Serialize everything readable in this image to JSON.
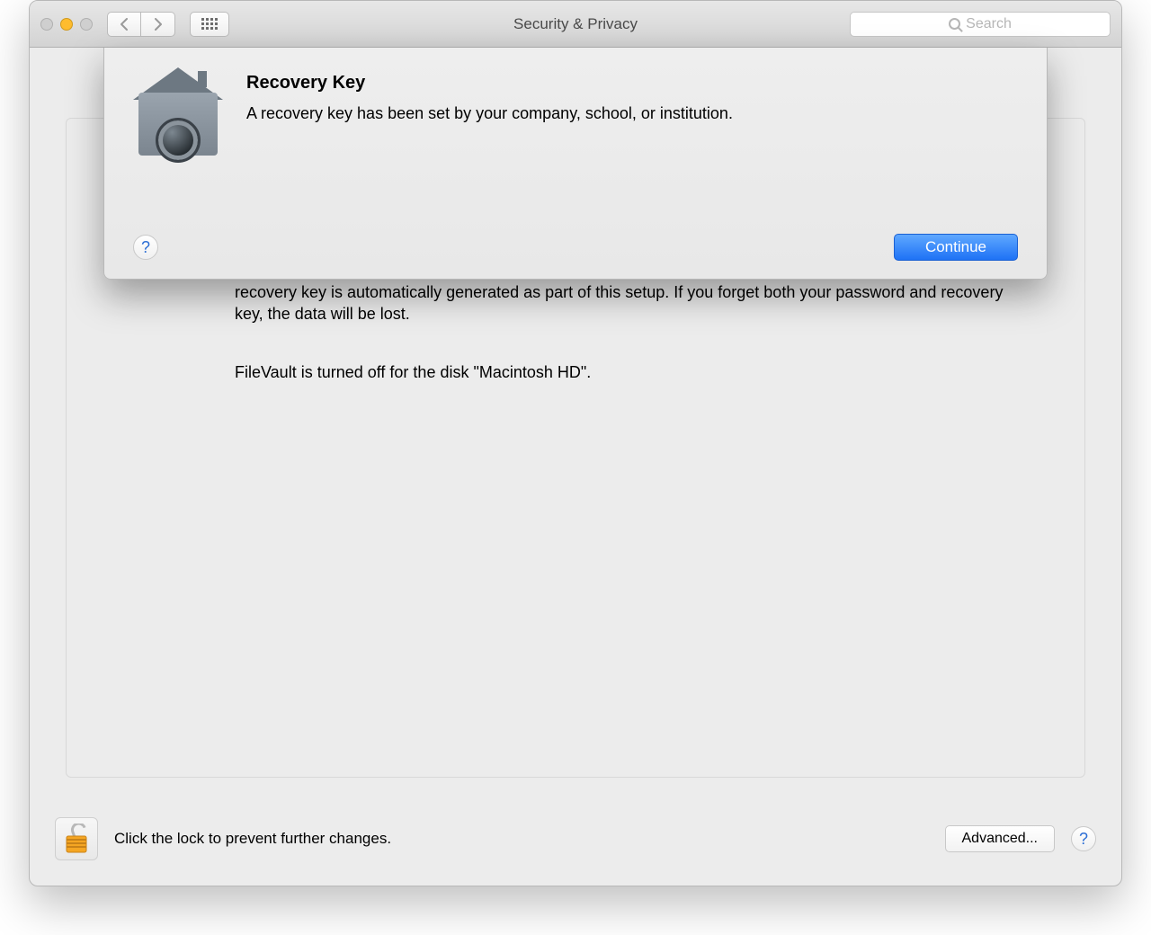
{
  "window": {
    "title": "Security & Privacy"
  },
  "toolbar": {
    "search_placeholder": "Search"
  },
  "sheet": {
    "heading": "Recovery Key",
    "message": "A recovery key has been set by your company, school, or institution.",
    "continue_label": "Continue",
    "help_label": "?"
  },
  "main": {
    "description_line2": "recovery key is automatically generated as part of this setup. If you forget both your password and recovery key, the data will be lost.",
    "status": "FileVault is turned off for the disk \"Macintosh HD\"."
  },
  "footer": {
    "lock_text": "Click the lock to prevent further changes.",
    "advanced_label": "Advanced...",
    "help_label": "?"
  }
}
